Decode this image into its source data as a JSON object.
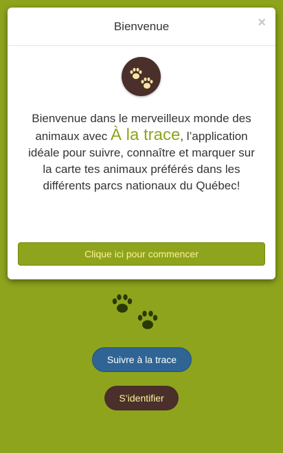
{
  "modal": {
    "title": "Bienvenue",
    "close_glyph": "×",
    "logo_icon": "paw-prints-icon",
    "body_part1": "Bienvenue dans le merveilleux monde des animaux avec ",
    "brand": "À la trace",
    "body_part2": ", l’application idéale pour suivre, connaître et marquer sur la carte tes animaux préférés dans les différents parcs nationaux du Québec!",
    "start_button": "Clique ici pour commencer"
  },
  "main": {
    "paw_icon": "paw-prints-icon",
    "follow_button": "Suivre à la trace",
    "login_button": "S’identifier"
  },
  "colors": {
    "background": "#8ea41c",
    "brand_green": "#8ea41c",
    "button_text_yellow": "#fdf29a",
    "follow_blue": "#2f6494",
    "login_brown": "#4a2f2b"
  }
}
